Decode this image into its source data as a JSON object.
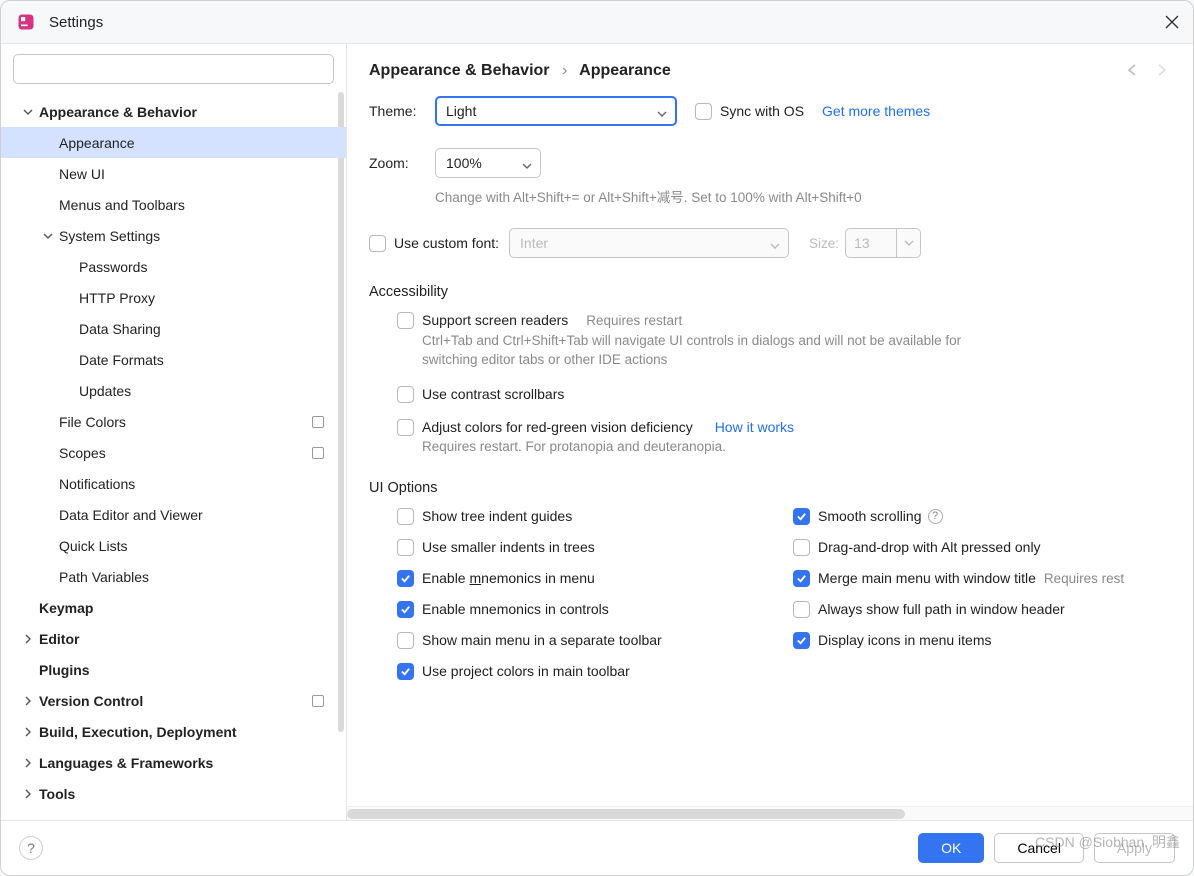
{
  "window": {
    "title": "Settings"
  },
  "search": {
    "placeholder": ""
  },
  "breadcrumb": {
    "a": "Appearance & Behavior",
    "b": "Appearance"
  },
  "sidebar": [
    {
      "label": "Appearance & Behavior",
      "level": 0,
      "bold": true,
      "expand": "down"
    },
    {
      "label": "Appearance",
      "level": 1,
      "selected": true
    },
    {
      "label": "New UI",
      "level": 1
    },
    {
      "label": "Menus and Toolbars",
      "level": 1
    },
    {
      "label": "System Settings",
      "level": 1,
      "expand": "down"
    },
    {
      "label": "Passwords",
      "level": 2
    },
    {
      "label": "HTTP Proxy",
      "level": 2
    },
    {
      "label": "Data Sharing",
      "level": 2
    },
    {
      "label": "Date Formats",
      "level": 2
    },
    {
      "label": "Updates",
      "level": 2
    },
    {
      "label": "File Colors",
      "level": 1,
      "tag": true
    },
    {
      "label": "Scopes",
      "level": 1,
      "tag": true
    },
    {
      "label": "Notifications",
      "level": 1
    },
    {
      "label": "Data Editor and Viewer",
      "level": 1
    },
    {
      "label": "Quick Lists",
      "level": 1
    },
    {
      "label": "Path Variables",
      "level": 1
    },
    {
      "label": "Keymap",
      "level": 0,
      "bold": true
    },
    {
      "label": "Editor",
      "level": 0,
      "bold": true,
      "expand": "right"
    },
    {
      "label": "Plugins",
      "level": 0,
      "bold": true
    },
    {
      "label": "Version Control",
      "level": 0,
      "bold": true,
      "expand": "right",
      "tag": true
    },
    {
      "label": "Build, Execution, Deployment",
      "level": 0,
      "bold": true,
      "expand": "right"
    },
    {
      "label": "Languages & Frameworks",
      "level": 0,
      "bold": true,
      "expand": "right"
    },
    {
      "label": "Tools",
      "level": 0,
      "bold": true,
      "expand": "right"
    }
  ],
  "theme": {
    "label": "Theme:",
    "value": "Light",
    "sync": "Sync with OS",
    "more": "Get more themes"
  },
  "zoom": {
    "label": "Zoom:",
    "value": "100%",
    "hint": "Change with Alt+Shift+= or Alt+Shift+减号. Set to 100% with Alt+Shift+0"
  },
  "font": {
    "label": "Use custom font:",
    "family": "Inter",
    "sizeLabel": "Size:",
    "size": "13"
  },
  "accessibility": {
    "title": "Accessibility",
    "screenReaders": "Support screen readers",
    "requiresRestart": "Requires restart",
    "srHint": "Ctrl+Tab and Ctrl+Shift+Tab will navigate UI controls in dialogs and will not be available for switching editor tabs or other IDE actions",
    "contrast": "Use contrast scrollbars",
    "colorDef": "Adjust colors for red-green vision deficiency",
    "howItWorks": "How it works",
    "colorDefHint": "Requires restart. For protanopia and deuteranopia."
  },
  "uiOptions": {
    "title": "UI Options",
    "left": [
      {
        "label": "Show tree indent guides",
        "checked": false
      },
      {
        "label": "Use smaller indents in trees",
        "checked": false
      },
      {
        "label": "Enable mnemonics in menu",
        "checked": true,
        "underline": "m"
      },
      {
        "label": "Enable mnemonics in controls",
        "checked": true
      },
      {
        "label": "Show main menu in a separate toolbar",
        "checked": false
      },
      {
        "label": "Use project colors in main toolbar",
        "checked": true
      }
    ],
    "right": [
      {
        "label": "Smooth scrolling",
        "checked": true,
        "help": true
      },
      {
        "label": "Drag-and-drop with Alt pressed only",
        "checked": false
      },
      {
        "label": "Merge main menu with window title",
        "checked": true,
        "trail": "Requires rest"
      },
      {
        "label": "Always show full path in window header",
        "checked": false
      },
      {
        "label": "Display icons in menu items",
        "checked": true
      }
    ]
  },
  "buttons": {
    "ok": "OK",
    "cancel": "Cancel",
    "apply": "Apply"
  },
  "watermark": "CSDN @Siobhan. 明鑫"
}
